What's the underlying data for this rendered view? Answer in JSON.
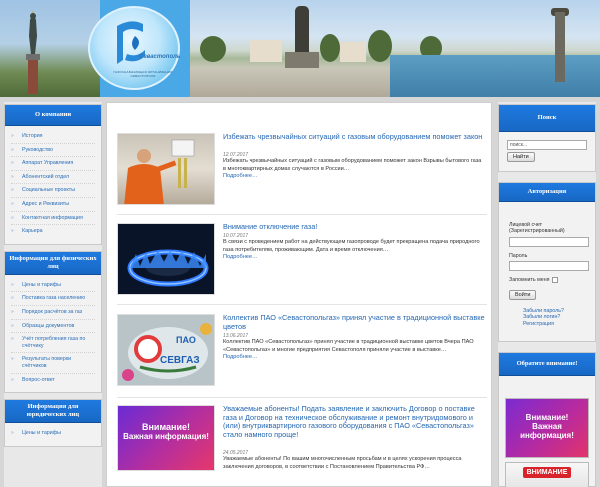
{
  "header": {
    "logo_text": "Севастополь",
    "logo_subtitle": "ГАЗОСНАБЖАЮЩАЯ  ОРГАНИЗАЦИЯ  СЕВАСТОПОЛЯ"
  },
  "left": {
    "about": {
      "title": "О компании",
      "items": [
        "История",
        "Руководство",
        "Аппарат Управления",
        "Абонентский отдел",
        "Социальные проекты",
        "Адрес и Реквизиты",
        "Контактная информация",
        "Карьера"
      ]
    },
    "individuals": {
      "title": "Информация для физических лиц",
      "items": [
        "Цены и тарифы",
        "Поставка газа населению",
        "Порядок расчётов за газ",
        "Образцы документов",
        "Учёт потребления газа по счётчику",
        "Результаты поверки счётчиков",
        "Вопрос-ответ"
      ]
    },
    "legal": {
      "title": "Информация для юридических лиц",
      "items": [
        "Цены и тарифы"
      ]
    }
  },
  "news": [
    {
      "title": "Избежать чрезвычайных ситуаций с газовым оборудованием поможет закон",
      "date": "12.07.2017",
      "excerpt": "Избежать чрезвычайных ситуаций с газовым оборудованием поможет закон Взрывы бытового газа в многоквартирных домах случаются в России…",
      "more": "Подробнее…"
    },
    {
      "title": "Внимание отключение газа!",
      "date": "10.07.2017",
      "excerpt": "В связи с проведением работ на действующем газопроводе будет прекращена подача природного газа потребителям, проживающим. Дата и время отключения…",
      "more": "Подробнее…"
    },
    {
      "title": "Коллектив ПАО «Севастопольгаз» принял участие в традиционной выставке цветов",
      "date": "13.06.2017",
      "excerpt": "Коллектив ПАО «Севастопольгаз» принял участие в традиционной выставке цветов Вчера ПАО «Севастопольгаз» и многие предприятия Севастополя приняли участие в выставке…",
      "more": "Подробнее…"
    },
    {
      "title": "Уважаемые абоненты! Подать заявление и заключить Договор о поставке газа и Договор на техническое обслуживание и ремонт внутридомового и (или) внутриквартирного газового оборудования с ПАО «Севастопольгаз» стало намного проще!",
      "date": "24.05.2017",
      "excerpt": "Уважаемые абоненты! По вашим многочисленным просьбам и в целях ускорения процесса заключения договоров, в соответствии с Постановлением Правительства РФ…",
      "more": ""
    }
  ],
  "thumb_texts": {
    "pao": "ПАО",
    "sevgaz": "СЕВГАЗ",
    "attention": "Внимание!",
    "important": "Важная информация!"
  },
  "right": {
    "search": {
      "title": "Поиск",
      "value": "поиск...",
      "button": "Найти"
    },
    "auth": {
      "title": "Авторизация",
      "account_label": "Лицевой счет (Зарегистрированный)",
      "password_label": "Пароль",
      "remember_label": "Запомнить меня",
      "login_button": "Войти",
      "forgot_password": "Забыли пароль?",
      "forgot_login": "Забыли логин?",
      "register": "Регистрация"
    },
    "notice": {
      "title": "Обратите внимание!",
      "promo1_line1": "Внимание!",
      "promo1_line2": "Важная информация!",
      "promo2_line1": "ВНИМАНИЕ"
    }
  }
}
